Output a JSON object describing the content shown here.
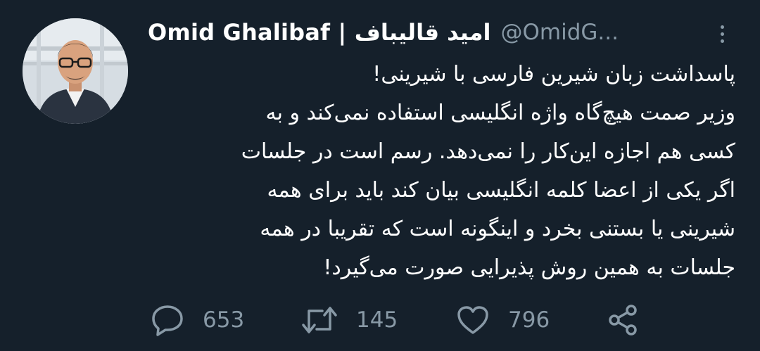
{
  "author": {
    "display_name": "Omid Ghalibaf | امید قالیباف",
    "handle": "@OmidG..."
  },
  "tweet": {
    "lines": [
      "پاسداشت زبان شیرین فارسی با شیرینی!",
      "وزیر صمت هیچ‌گاه واژه انگلیسی استفاده نمی‌کند و به",
      "کسی هم اجازه این‌کار را نمی‌دهد. رسم است در جلسات",
      "اگر یکی از اعضا کلمه انگلیسی بیان کند باید برای همه",
      "شیرینی یا بستنی بخرد و اینگونه است که تقریبا در همه",
      "جلسات به همین روش پذیرایی صورت می‌گیرد!"
    ]
  },
  "actions": {
    "reply_count": "653",
    "retweet_count": "145",
    "like_count": "796"
  },
  "icons": {
    "more": "more-vertical-icon",
    "reply": "reply-icon",
    "retweet": "retweet-icon",
    "like": "heart-icon",
    "share": "share-icon"
  },
  "colors": {
    "background": "#15202b",
    "text": "#ffffff",
    "secondary": "#8899a6"
  }
}
